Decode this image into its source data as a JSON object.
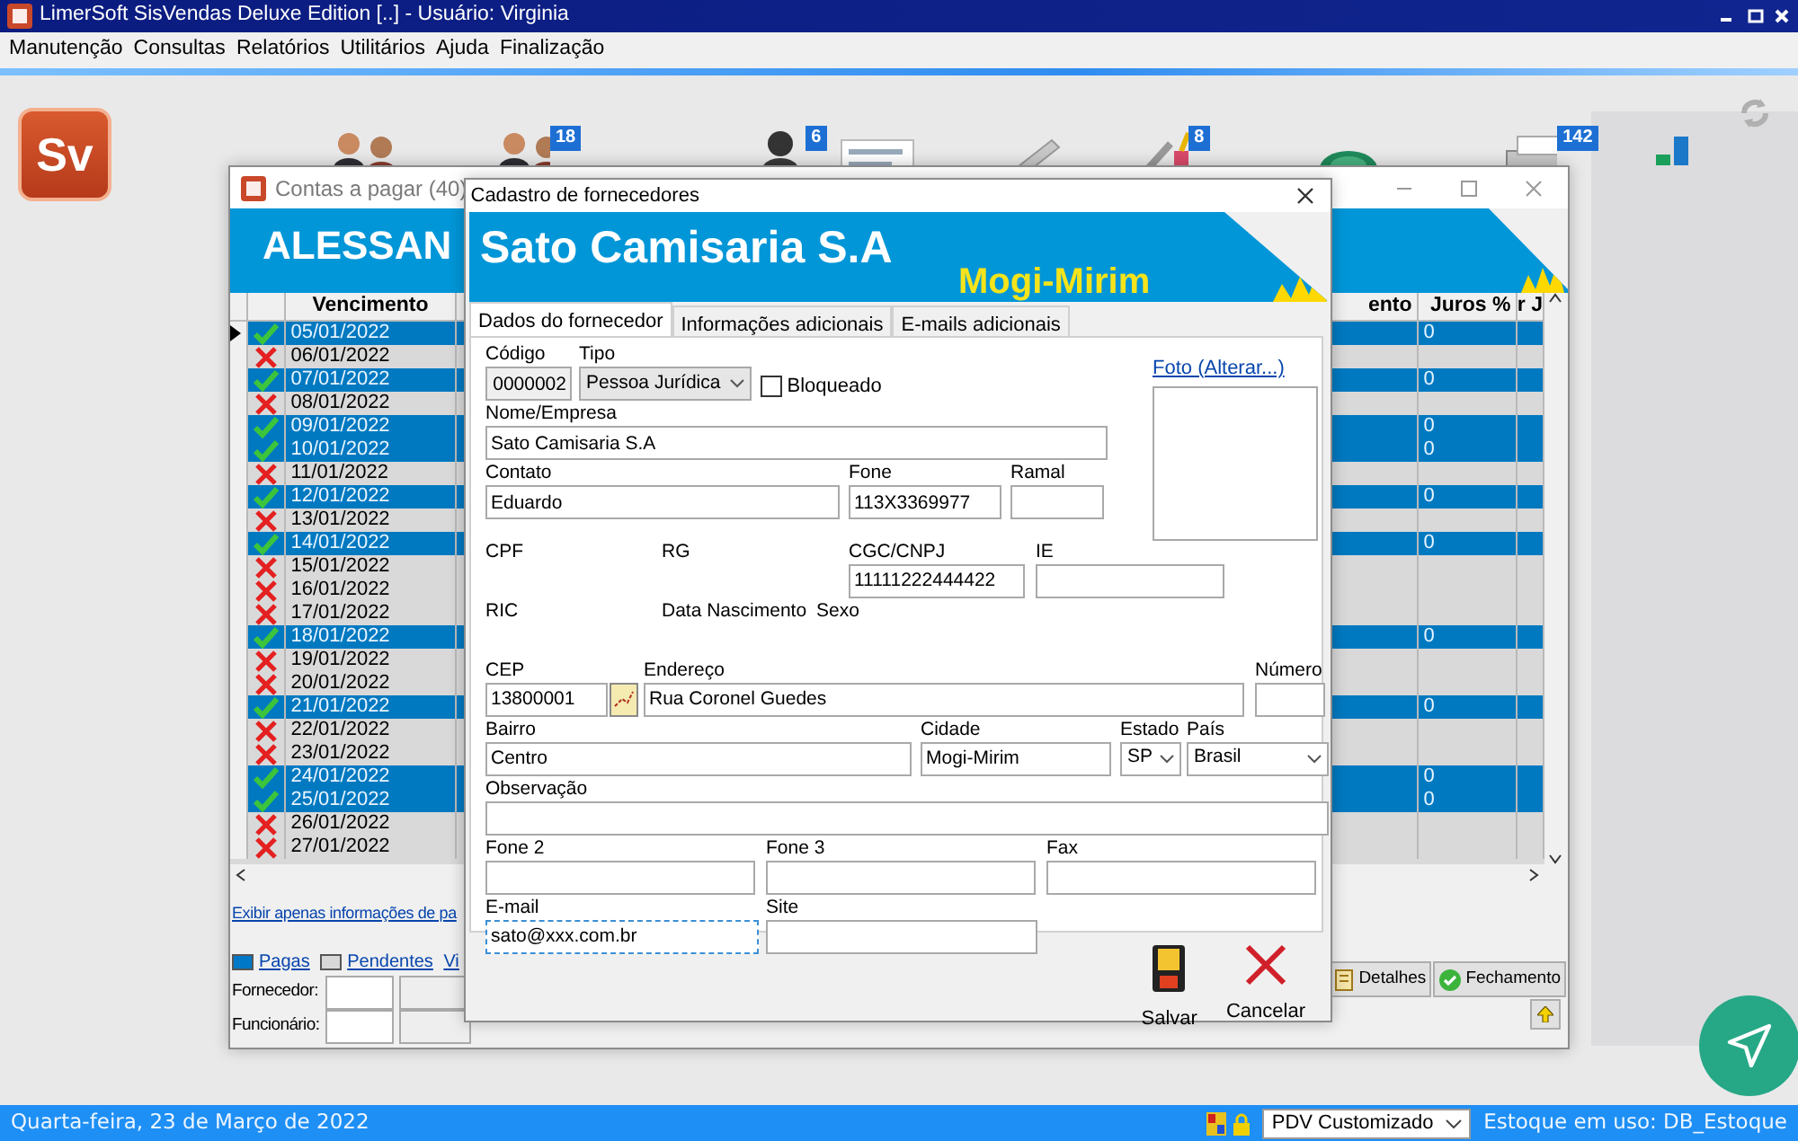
{
  "app": {
    "title": "LimerSoft SisVendas Deluxe Edition [..] - Usuário: Virginia",
    "logo_text": "Sv",
    "menu": [
      "Manutenção",
      "Consultas",
      "Relatórios",
      "Utilitários",
      "Ajuda",
      "Finalização"
    ]
  },
  "toolbar": [
    {
      "kind": "people"
    },
    {
      "kind": "people",
      "badge": "18"
    },
    {
      "kind": "person",
      "badge": "6"
    },
    {
      "kind": "document"
    },
    {
      "kind": "pen"
    },
    {
      "kind": "tools",
      "badge": "8"
    },
    {
      "kind": "money"
    },
    {
      "kind": "printer",
      "badge": "142"
    },
    {
      "kind": "chart"
    }
  ],
  "contas_window": {
    "title": "Contas a pagar (40)",
    "banner": "ALESSAN",
    "columns": [
      "Vencimento",
      "ento",
      "Juros %",
      "r J"
    ],
    "rows": [
      {
        "current": true,
        "paid": true,
        "vencimento": "05/01/2022",
        "juros": "0"
      },
      {
        "current": false,
        "paid": false,
        "vencimento": "06/01/2022"
      },
      {
        "current": false,
        "paid": true,
        "vencimento": "07/01/2022",
        "juros": "0"
      },
      {
        "current": false,
        "paid": false,
        "vencimento": "08/01/2022"
      },
      {
        "current": false,
        "paid": true,
        "vencimento": "09/01/2022",
        "juros": "0"
      },
      {
        "current": false,
        "paid": true,
        "vencimento": "10/01/2022",
        "juros": "0"
      },
      {
        "current": false,
        "paid": false,
        "vencimento": "11/01/2022"
      },
      {
        "current": false,
        "paid": true,
        "vencimento": "12/01/2022",
        "juros": "0"
      },
      {
        "current": false,
        "paid": false,
        "vencimento": "13/01/2022"
      },
      {
        "current": false,
        "paid": true,
        "vencimento": "14/01/2022",
        "juros": "0"
      },
      {
        "current": false,
        "paid": false,
        "vencimento": "15/01/2022"
      },
      {
        "current": false,
        "paid": false,
        "vencimento": "16/01/2022"
      },
      {
        "current": false,
        "paid": false,
        "vencimento": "17/01/2022"
      },
      {
        "current": false,
        "paid": true,
        "vencimento": "18/01/2022",
        "juros": "0"
      },
      {
        "current": false,
        "paid": false,
        "vencimento": "19/01/2022"
      },
      {
        "current": false,
        "paid": false,
        "vencimento": "20/01/2022"
      },
      {
        "current": false,
        "paid": true,
        "vencimento": "21/01/2022",
        "juros": "0"
      },
      {
        "current": false,
        "paid": false,
        "vencimento": "22/01/2022"
      },
      {
        "current": false,
        "paid": false,
        "vencimento": "23/01/2022"
      },
      {
        "current": false,
        "paid": true,
        "vencimento": "24/01/2022",
        "juros": "0"
      },
      {
        "current": false,
        "paid": true,
        "vencimento": "25/01/2022",
        "juros": "0"
      },
      {
        "current": false,
        "paid": false,
        "vencimento": "26/01/2022"
      },
      {
        "current": false,
        "paid": false,
        "vencimento": "27/01/2022"
      }
    ],
    "filter_link": "Exibir apenas informações de pa",
    "legend": [
      {
        "label": "Pagas",
        "color": "#0078c8"
      },
      {
        "label": "Pendentes",
        "color": "#d8d8d8"
      },
      {
        "label": "Vi"
      }
    ],
    "filters": [
      "Fornecedor:",
      "Funcionário:"
    ],
    "buttons": [
      {
        "kind": "details",
        "label": "Detalhes"
      },
      {
        "kind": "close",
        "label": "Fechamento"
      }
    ]
  },
  "dialog": {
    "title": "Cadastro de fornecedores",
    "banner_name": "Sato Camisaria S.A",
    "banner_city": "Mogi-Mirim",
    "tabs": [
      {
        "label": "Dados do fornecedor",
        "selected": true
      },
      {
        "label": "Informações adicionais",
        "selected": false
      },
      {
        "label": "E-mails adicionais",
        "selected": false
      }
    ],
    "photo_link": "Foto (Alterar...)",
    "form_rows": [
      [
        {
          "kind": "text",
          "label": "Código",
          "value": "0000002",
          "disabled": true,
          "focused": false
        },
        {
          "kind": "select",
          "label": "Tipo",
          "value": "Pessoa Jurídica"
        },
        {
          "kind": "checkbox",
          "label": "Bloqueado",
          "checked": false
        }
      ],
      [
        {
          "kind": "text",
          "label": "Nome/Empresa",
          "value": "Sato Camisaria S.A",
          "disabled": false,
          "focused": false
        }
      ],
      [
        {
          "kind": "text",
          "label": "Contato",
          "value": "Eduardo",
          "disabled": false,
          "focused": false
        },
        {
          "kind": "text",
          "label": "Fone",
          "value": "113X3369977",
          "disabled": false,
          "focused": false
        },
        {
          "kind": "text",
          "label": "Ramal",
          "disabled": false,
          "focused": false
        }
      ],
      [
        {
          "kind": "label",
          "label": "CPF"
        },
        {
          "kind": "label",
          "label": "RG"
        },
        {
          "kind": "text",
          "label": "CGC/CNPJ",
          "value": "11111222444422",
          "disabled": false,
          "focused": false
        },
        {
          "kind": "text",
          "label": "IE",
          "disabled": false,
          "focused": false
        }
      ],
      [
        {
          "kind": "label",
          "label": "RIC"
        },
        {
          "kind": "label",
          "label": "Data Nascimento"
        },
        {
          "kind": "label",
          "label": "Sexo"
        }
      ],
      [
        {
          "kind": "text",
          "label": "CEP",
          "value": "13800001",
          "disabled": false,
          "focused": false
        },
        {
          "kind": "mapbutton"
        },
        {
          "kind": "text",
          "label": "Endereço",
          "value": "Rua Coronel Guedes",
          "disabled": false,
          "focused": false
        },
        {
          "kind": "text",
          "label": "Número",
          "disabled": false,
          "focused": false
        }
      ],
      [
        {
          "kind": "text",
          "label": "Bairro",
          "value": "Centro",
          "disabled": false,
          "focused": false
        },
        {
          "kind": "text",
          "label": "Cidade",
          "value": "Mogi-Mirim",
          "disabled": false,
          "focused": false
        },
        {
          "kind": "select",
          "label": "Estado",
          "value": "SP"
        },
        {
          "kind": "select",
          "label": "País",
          "value": "Brasil"
        }
      ],
      [
        {
          "kind": "text",
          "label": "Observação",
          "disabled": false,
          "focused": false
        }
      ],
      [
        {
          "kind": "text",
          "label": "Fone 2",
          "disabled": false,
          "focused": false
        },
        {
          "kind": "text",
          "label": "Fone 3",
          "disabled": false,
          "focused": false
        },
        {
          "kind": "text",
          "label": "Fax",
          "disabled": false,
          "focused": false
        }
      ],
      [
        {
          "kind": "text",
          "label": "E-mail",
          "value": "sato@xxx.com.br",
          "disabled": false,
          "focused": true
        },
        {
          "kind": "text",
          "label": "Site",
          "disabled": false,
          "focused": false
        }
      ]
    ],
    "buttons": [
      {
        "kind": "save",
        "label": "Salvar"
      },
      {
        "kind": "cancel",
        "label": "Cancelar"
      }
    ]
  },
  "status_bar": {
    "date": "Quarta-feira, 23 de Março de 2022",
    "profile": "PDV Customizado",
    "stock": "Estoque em uso: DB_Estoque"
  }
}
